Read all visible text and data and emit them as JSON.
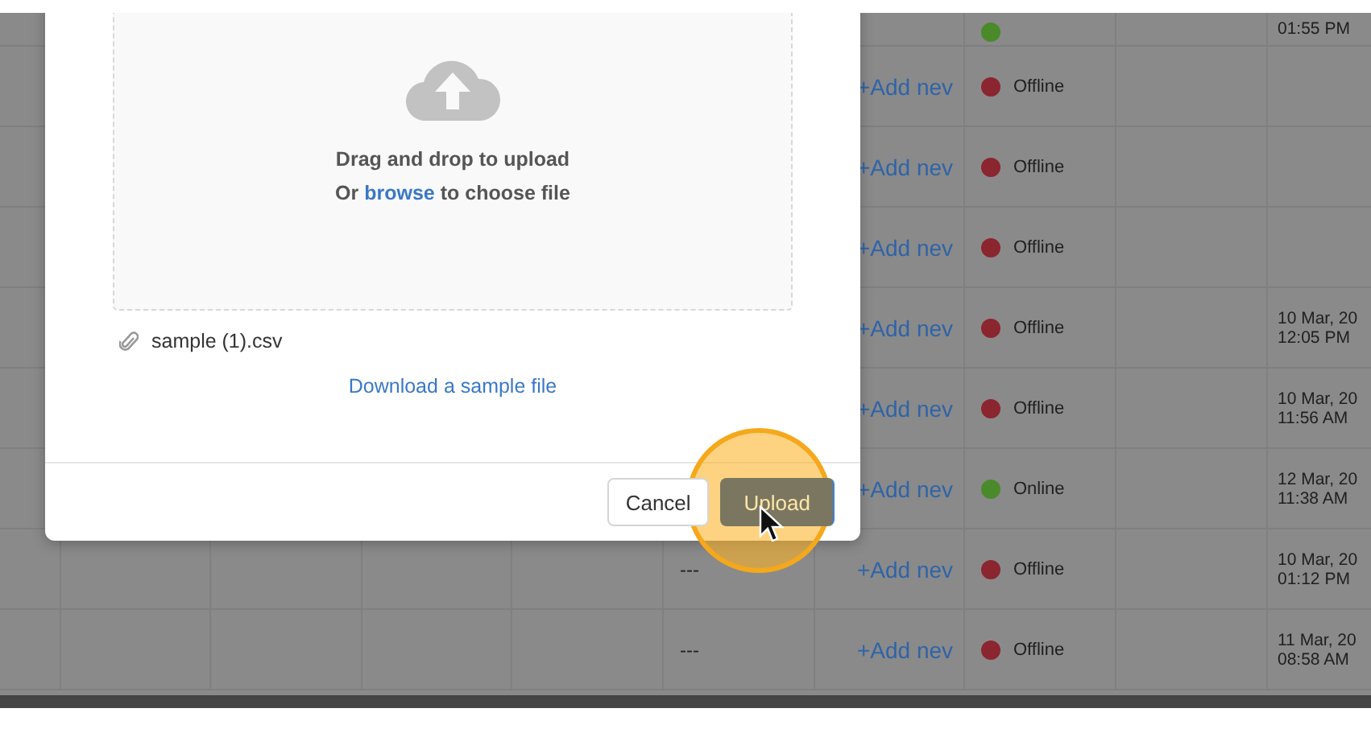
{
  "table": {
    "rows": [
      {
        "kind": "partial",
        "online": true,
        "date_lines": [
          "01:55 PM"
        ]
      },
      {
        "kind": "full",
        "link": "+Add nev",
        "online": false,
        "status": "Offline",
        "date_lines": []
      },
      {
        "kind": "full",
        "link": "+Add nev",
        "online": false,
        "status": "Offline",
        "date_lines": []
      },
      {
        "kind": "full",
        "link": "+Add nev",
        "online": false,
        "status": "Offline",
        "date_lines": []
      },
      {
        "kind": "full",
        "link": "+Add nev",
        "online": false,
        "status": "Offline",
        "date_lines": [
          "10 Mar, 20",
          "12:05 PM"
        ]
      },
      {
        "kind": "full",
        "link": "+Add nev",
        "online": false,
        "status": "Offline",
        "date_lines": [
          "10 Mar, 20",
          "11:56 AM"
        ]
      },
      {
        "kind": "full",
        "link": "+Add nev",
        "online": true,
        "status": "Online",
        "date_lines": [
          "12 Mar, 20",
          "11:38 AM"
        ]
      },
      {
        "kind": "full",
        "column_6": "---",
        "link": "+Add nev",
        "online": false,
        "status": "Offline",
        "date_lines": [
          "10 Mar, 20",
          "01:12 PM"
        ]
      },
      {
        "kind": "full",
        "column_6": "---",
        "link": "+Add nev",
        "online": false,
        "status": "Offline",
        "date_lines": [
          "11 Mar, 20",
          "08:58 AM"
        ]
      }
    ]
  },
  "dialog": {
    "dropzone": {
      "title": "Drag and drop to upload",
      "prompt_before": "Or",
      "browse_link": "browse",
      "prompt_after": "to choose file"
    },
    "attachment": "sample (1).csv",
    "sample_link": "Download a sample file",
    "buttons": [
      {
        "kind": "secondary",
        "label": "Cancel"
      },
      {
        "kind": "primary",
        "label": "Upload"
      }
    ]
  }
}
